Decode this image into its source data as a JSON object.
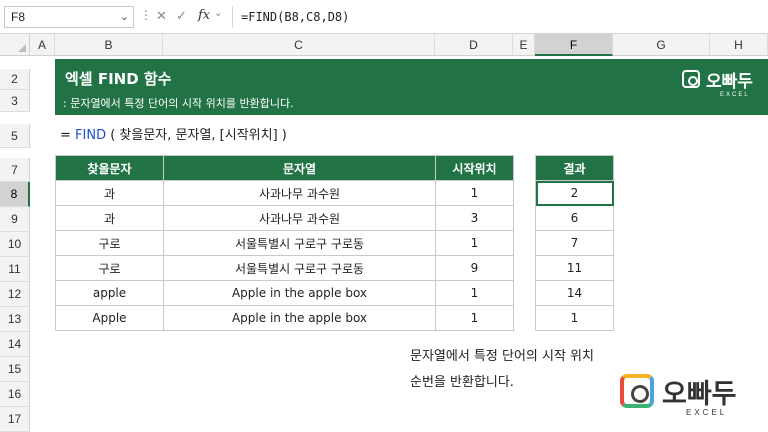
{
  "formula_bar": {
    "name_box": "F8",
    "cancel_icon": "✕",
    "enter_icon": "✓",
    "fx_label": "fx",
    "formula": "=FIND(B8,C8,D8)"
  },
  "columns": [
    "A",
    "B",
    "C",
    "D",
    "E",
    "F",
    "G",
    "H"
  ],
  "rows": [
    "2",
    "3",
    "5",
    "7",
    "8",
    "9",
    "10",
    "11",
    "12",
    "13",
    "14",
    "15",
    "16",
    "17"
  ],
  "selected_column": "F",
  "selected_row": "8",
  "banner": {
    "title": "엑셀 FIND 함수",
    "subtitle": ": 문자열에서 특정 단어의 시작 위치를 반환합니다.",
    "logo_text": "오빠두",
    "logo_sub": "EXCEL",
    "color": "#217346"
  },
  "syntax": {
    "prefix": "= ",
    "fn": "FIND",
    "args": " ( 찾을문자, 문자열, [시작위치] )"
  },
  "table": {
    "headers": [
      "찾을문자",
      "문자열",
      "시작위치"
    ],
    "rows": [
      [
        "과",
        "사과나무 과수원",
        "1"
      ],
      [
        "과",
        "사과나무 과수원",
        "3"
      ],
      [
        "구로",
        "서울특별시 구로구 구로동",
        "1"
      ],
      [
        "구로",
        "서울특별시 구로구 구로동",
        "9"
      ],
      [
        "apple",
        "Apple in the apple box",
        "1"
      ],
      [
        "Apple",
        "Apple in the apple box",
        "1"
      ]
    ]
  },
  "result": {
    "header": "결과",
    "values": [
      "2",
      "6",
      "7",
      "11",
      "14",
      "1"
    ]
  },
  "note": {
    "line1": "문자열에서 특정 단어의 시작 위치",
    "line2": "순번을 반환합니다."
  },
  "brand_logo": {
    "text": "오빠두",
    "sub": "EXCEL"
  }
}
